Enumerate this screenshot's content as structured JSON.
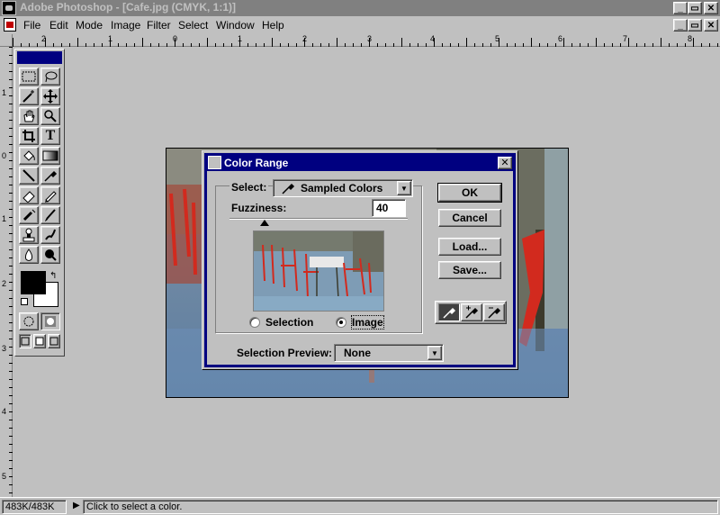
{
  "window": {
    "title": "Adobe Photoshop - [Cafe.jpg  (CMYK, 1:1)]",
    "controls": [
      "_",
      "▭",
      "✕"
    ],
    "doc_controls": [
      "_",
      "▭",
      "✕"
    ]
  },
  "menu": {
    "items": [
      {
        "label": "File"
      },
      {
        "label": "Edit"
      },
      {
        "label": "Mode"
      },
      {
        "label": "Image"
      },
      {
        "label": "Filter"
      },
      {
        "label": "Select"
      },
      {
        "label": "Window"
      },
      {
        "label": "Help"
      }
    ]
  },
  "rulers": {
    "top": [
      "2",
      "1",
      "0",
      "1",
      "2",
      "3",
      "4",
      "5",
      "6",
      "7",
      "8"
    ],
    "left": [
      "1",
      "0",
      "1",
      "2",
      "3",
      "4",
      "5"
    ]
  },
  "toolbox": {
    "tools": [
      "marquee-icon",
      "lasso-icon",
      "magic-wand-icon",
      "move-icon",
      "hand-icon",
      "zoom-icon",
      "crop-icon",
      "type-icon",
      "paint-bucket-icon",
      "gradient-icon",
      "line-icon",
      "eyedropper-icon",
      "eraser-icon",
      "pencil-icon",
      "airbrush-icon",
      "paintbrush-icon",
      "rubber-stamp-icon",
      "smudge-icon",
      "blur-icon",
      "burn-icon"
    ],
    "type_glyph": "T"
  },
  "dialog": {
    "title": "Color Range",
    "select_label": "Select:",
    "select_value": "Sampled Colors",
    "fuzziness_label": "Fuzziness:",
    "fuzziness_value": "40",
    "radio_selection": "Selection",
    "radio_image": "Image",
    "selected_radio": "Image",
    "selection_preview_label": "Selection Preview:",
    "selection_preview_value": "None",
    "buttons": {
      "ok": "OK",
      "cancel": "Cancel",
      "load": "Load...",
      "save": "Save..."
    },
    "eyedroppers": [
      "eyedropper-icon",
      "eyedropper-plus-icon",
      "eyedropper-minus-icon"
    ]
  },
  "status": {
    "doc_size": "483K/483K",
    "message": "Click to select a color."
  },
  "colors": {
    "title_inactive": "#808080",
    "dialog_title": "#000080",
    "chair_red": "#d22a1e"
  }
}
